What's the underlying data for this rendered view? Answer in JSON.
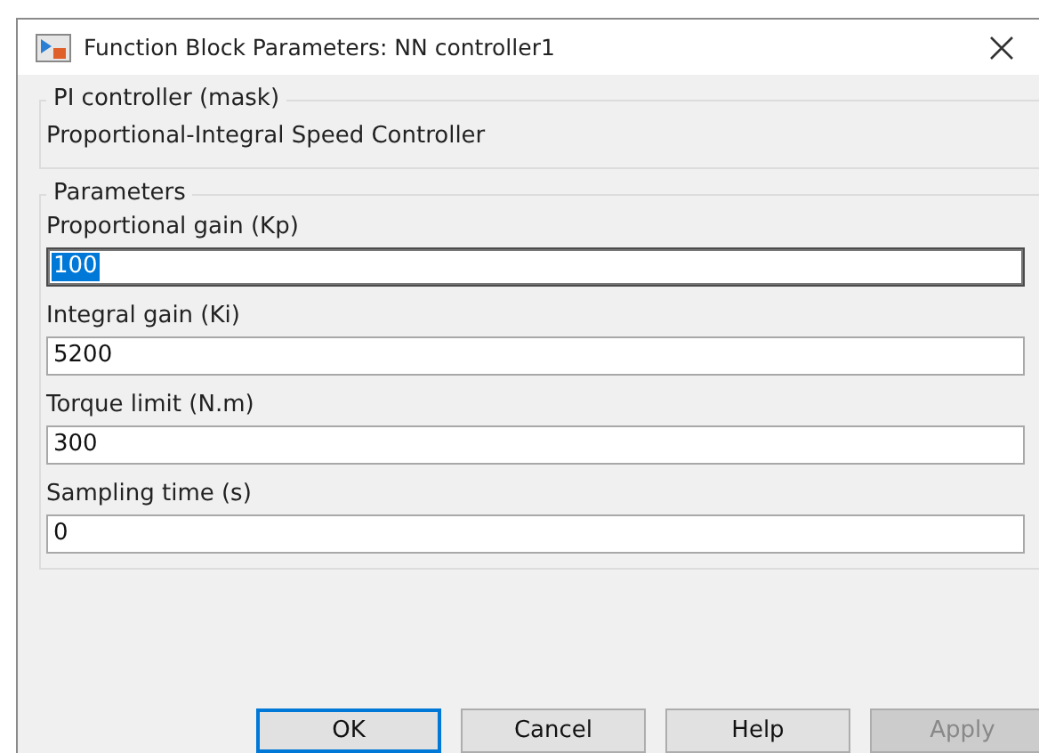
{
  "window": {
    "title": "Function Block Parameters: NN controller1"
  },
  "description": {
    "title": "PI controller (mask)",
    "text": "Proportional-Integral Speed Controller"
  },
  "parameters": {
    "title": "Parameters",
    "fields": [
      {
        "label": "Proportional gain (Kp)",
        "value": "100",
        "focused": true,
        "text_selected": true
      },
      {
        "label": "Integral gain (Ki)",
        "value": "5200",
        "focused": false,
        "text_selected": false
      },
      {
        "label": "Torque limit (N.m)",
        "value": "300",
        "focused": false,
        "text_selected": false
      },
      {
        "label": "Sampling time (s)",
        "value": "0",
        "focused": false,
        "text_selected": false
      }
    ]
  },
  "buttons": [
    {
      "label": "OK",
      "default": true,
      "disabled": false
    },
    {
      "label": "Cancel",
      "default": false,
      "disabled": false
    },
    {
      "label": "Help",
      "default": false,
      "disabled": false
    },
    {
      "label": "Apply",
      "default": false,
      "disabled": true
    }
  ]
}
